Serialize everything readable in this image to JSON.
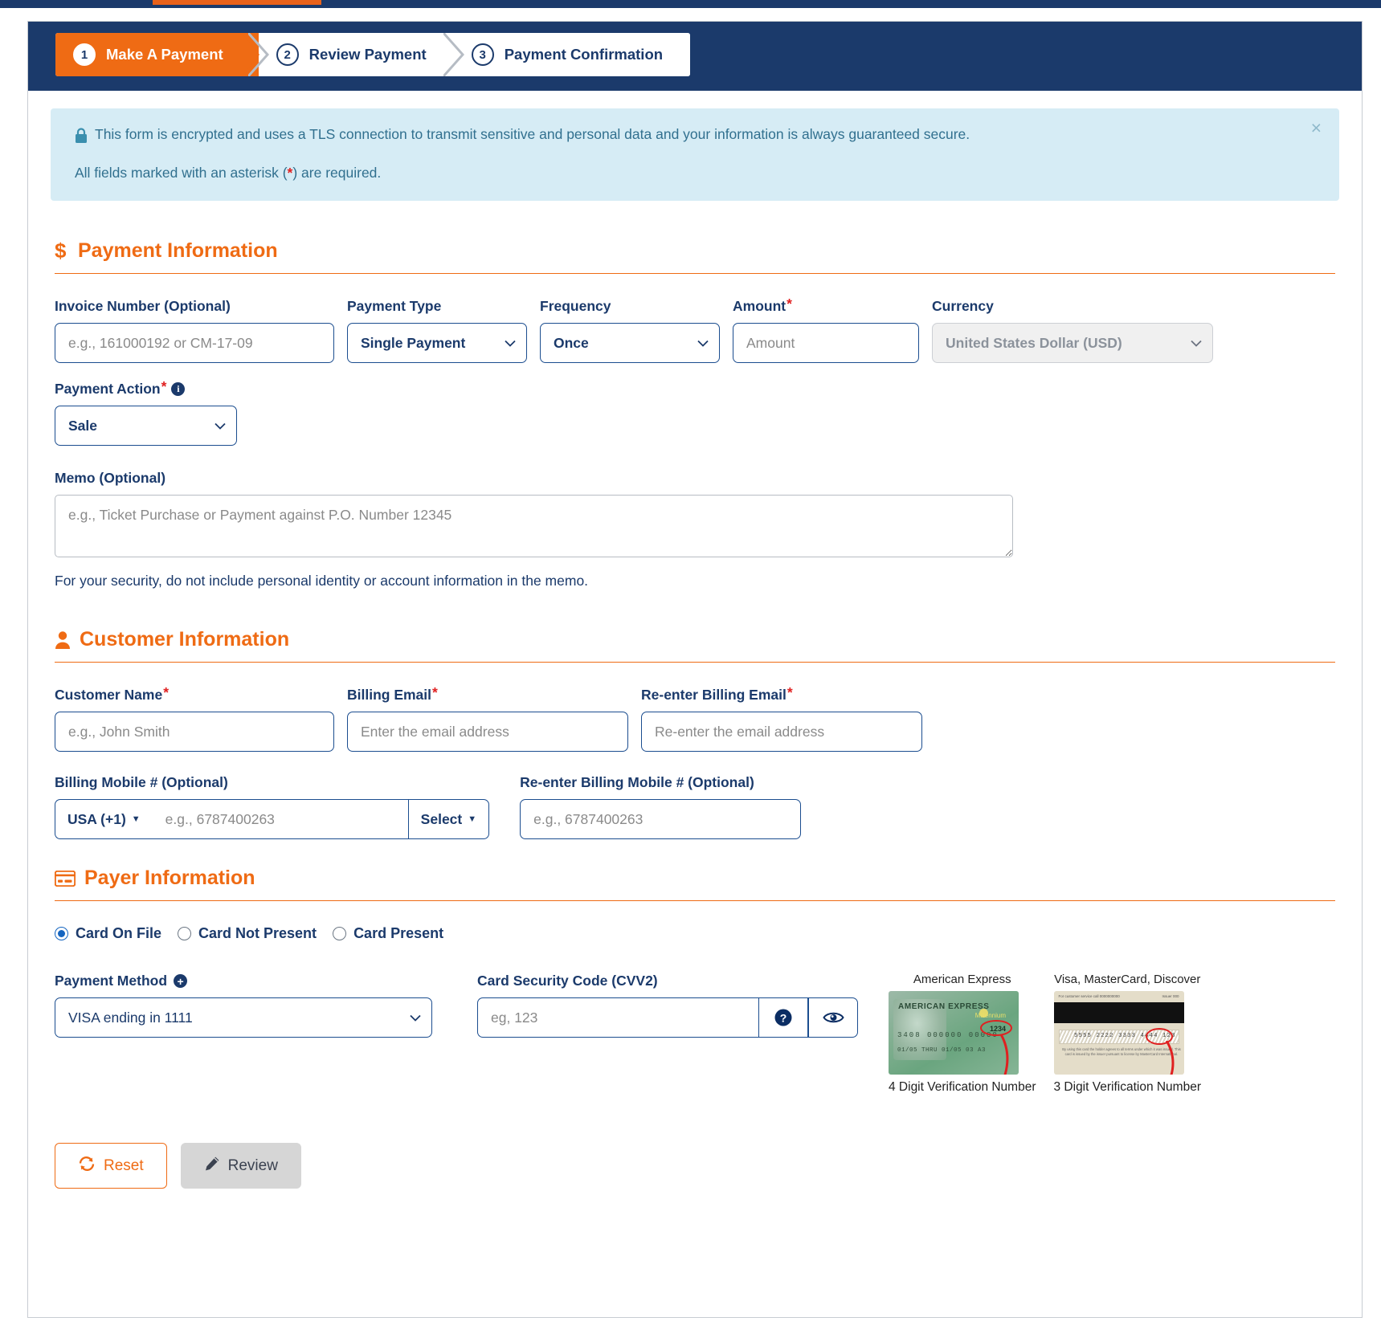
{
  "wizard": {
    "steps": [
      {
        "num": "1",
        "label": "Make A Payment",
        "active": true
      },
      {
        "num": "2",
        "label": "Review Payment",
        "active": false
      },
      {
        "num": "3",
        "label": "Payment Confirmation",
        "active": false
      }
    ]
  },
  "alert": {
    "icon": "lock-icon",
    "line1": "This form is encrypted and uses a TLS connection to transmit sensitive and personal data and your information is always guaranteed secure.",
    "line2_before": "All fields marked with an asterisk (",
    "line2_star": "*",
    "line2_after": ") are required.",
    "close_label": "×"
  },
  "payment_information": {
    "heading": "Payment Information",
    "icon": "dollar-icon",
    "invoice": {
      "label": "Invoice Number (Optional)",
      "placeholder": "e.g., 161000192 or CM-17-09",
      "value": ""
    },
    "payment_type": {
      "label": "Payment Type",
      "value": "Single Payment",
      "options": [
        "Single Payment"
      ]
    },
    "frequency": {
      "label": "Frequency",
      "value": "Once",
      "options": [
        "Once"
      ]
    },
    "amount": {
      "label": "Amount",
      "required": "*",
      "placeholder": "Amount",
      "value": ""
    },
    "currency": {
      "label": "Currency",
      "value": "United States Dollar (USD)",
      "options": [
        "United States Dollar (USD)"
      ],
      "disabled": true
    },
    "payment_action": {
      "label": "Payment Action",
      "required": "*",
      "info": "i",
      "value": "Sale",
      "options": [
        "Sale"
      ]
    },
    "memo": {
      "label": "Memo (Optional)",
      "placeholder": "e.g., Ticket Purchase or Payment against P.O. Number 12345",
      "value": "",
      "note": "For your security, do not include personal identity or account information in the memo."
    }
  },
  "customer_information": {
    "heading": "Customer Information",
    "icon": "user-icon",
    "customer_name": {
      "label": "Customer Name",
      "required": "*",
      "placeholder": "e.g., John Smith",
      "value": ""
    },
    "billing_email": {
      "label": "Billing Email",
      "required": "*",
      "placeholder": "Enter the email address",
      "value": ""
    },
    "reenter_billing_email": {
      "label": "Re-enter Billing Email",
      "required": "*",
      "placeholder": "Re-enter the email address",
      "value": ""
    },
    "billing_mobile": {
      "label": "Billing Mobile # (Optional)",
      "country_code": "USA (+1)",
      "placeholder": "e.g., 6787400263",
      "value": "",
      "select_label": "Select"
    },
    "reenter_billing_mobile": {
      "label": "Re-enter Billing Mobile # (Optional)",
      "placeholder": "e.g., 6787400263",
      "value": ""
    }
  },
  "payer_information": {
    "heading": "Payer Information",
    "icon": "credit-card-icon",
    "card_options": [
      {
        "label": "Card On File",
        "checked": true
      },
      {
        "label": "Card Not Present",
        "checked": false
      },
      {
        "label": "Card Present",
        "checked": false
      }
    ],
    "payment_method": {
      "label": "Payment Method",
      "add_icon": "plus-circle-icon",
      "value": "VISA ending in 1111",
      "options": [
        "VISA ending in 1111"
      ]
    },
    "cvv": {
      "label": "Card Security Code (CVV2)",
      "placeholder": "eg, 123",
      "value": "",
      "help_icon": "question-circle-icon",
      "reveal_icon": "eye-icon"
    },
    "card_help": [
      {
        "title": "American Express",
        "caption": "4 Digit Verification Number",
        "brand_text": "AMERICAN EXPRESS",
        "program_text": "Millennium",
        "card_number": "3408 000000 00000",
        "dates": "01/05  THRU 01/05   03    A3",
        "cvv_digits": "1234"
      },
      {
        "title": "Visa, MasterCard, Discover",
        "caption": "3 Digit Verification Number",
        "service_text": "For customer service call 0000000000",
        "signature_label": "Authorized signature",
        "sig_number": "5555 2222 3333 4444  123",
        "fine_print": "By using this card the holder agrees to all terms under which it was issued. This card is issued by the issuer pursuant to license by MasterCard International."
      }
    ]
  },
  "buttons": {
    "reset": {
      "label": "Reset",
      "icon": "refresh-icon"
    },
    "review": {
      "label": "Review",
      "icon": "pencil-icon"
    }
  },
  "colors": {
    "brand_orange": "#ef6b14",
    "brand_navy": "#1b3a6b",
    "alert_bg": "#d6ecf5",
    "alert_text": "#31708f",
    "required_red": "#e02020"
  }
}
